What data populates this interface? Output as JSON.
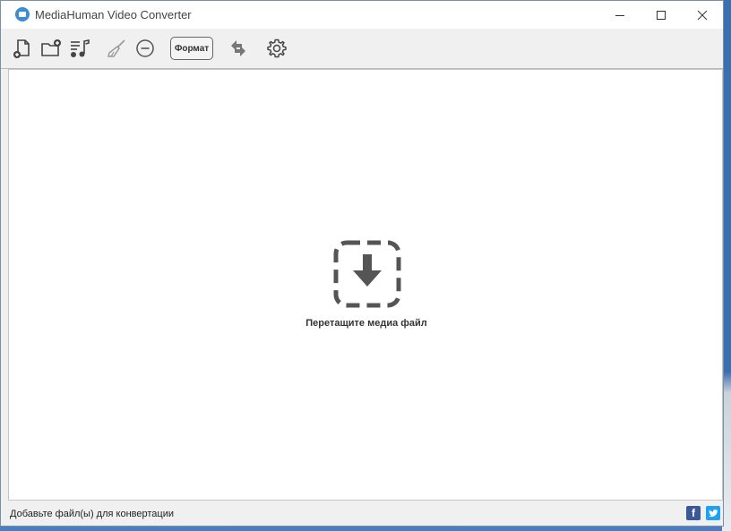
{
  "window": {
    "title": "MediaHuman Video Converter",
    "app_icon": "mediahuman-icon",
    "controls": {
      "minimize": "minimize-icon",
      "maximize": "maximize-icon",
      "close": "close-icon"
    }
  },
  "toolbar": {
    "buttons": [
      {
        "icon": "add-file-icon"
      },
      {
        "icon": "add-folder-icon"
      },
      {
        "icon": "add-music-playlist-icon"
      },
      {
        "icon": "broom-icon"
      },
      {
        "icon": "remove-circle-icon"
      },
      {
        "icon": "convert-arrows-icon"
      },
      {
        "icon": "gear-icon"
      }
    ],
    "format_label": "Формат"
  },
  "main": {
    "drop_icon": "download-arrow-icon",
    "drop_hint": "Перетащите медиа файл"
  },
  "statusbar": {
    "text": "Добавьте файл(ы) для конвертации",
    "social": [
      {
        "icon": "facebook-icon",
        "glyph": "f",
        "color": "#3b5998"
      },
      {
        "icon": "twitter-icon",
        "color": "#1da1f2"
      }
    ]
  },
  "colors": {
    "accent": "#3a8ed8",
    "icon_gray": "#555555",
    "window_bg": "#f0f0f0"
  }
}
